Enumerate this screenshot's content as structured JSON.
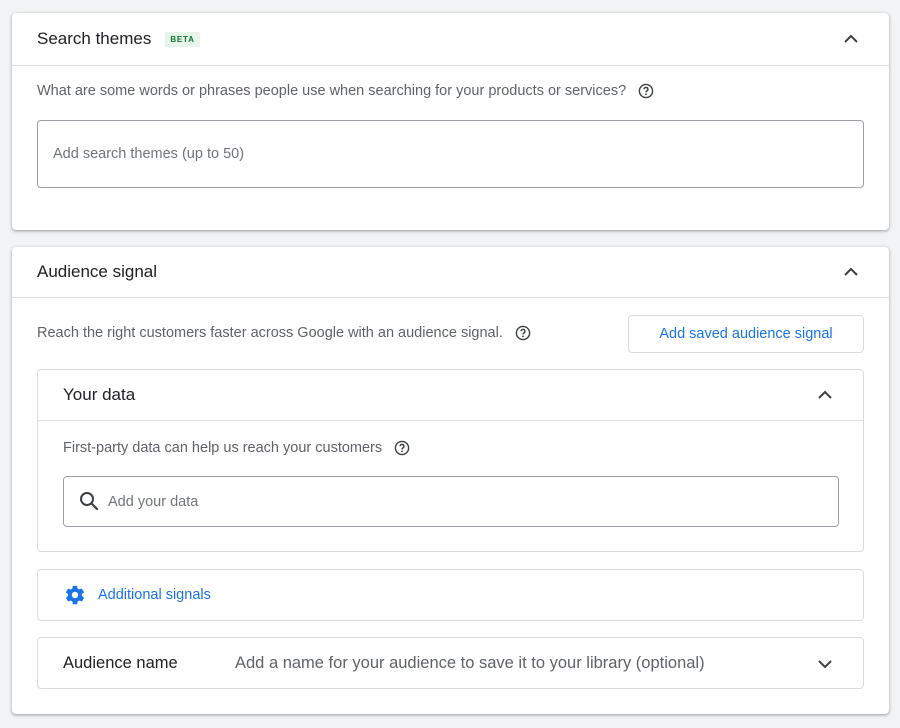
{
  "search_themes": {
    "title": "Search themes",
    "badge": "BETA",
    "question": "What are some words or phrases people use when searching for your products or services?",
    "input_placeholder": "Add search themes (up to 50)",
    "chevron_icon": "chevron-up-icon",
    "help_icon": "help-circle-icon"
  },
  "audience_signal": {
    "title": "Audience signal",
    "description": "Reach the right customers faster across Google with an audience signal.",
    "add_saved_button": "Add saved audience signal",
    "your_data": {
      "title": "Your data",
      "description": "First-party data can help us reach your customers",
      "input_placeholder": "Add your data",
      "search_icon": "search-icon"
    },
    "additional_signals": {
      "label": "Additional signals",
      "icon": "gear-icon"
    },
    "audience_name": {
      "label": "Audience name",
      "placeholder": "Add a name for your audience to save it to your library (optional)",
      "chevron_icon": "chevron-down-icon"
    }
  },
  "colors": {
    "accent": "#1a73e8",
    "badge_bg": "#e6f4ea",
    "badge_text": "#137333",
    "secondary_text": "#5f6368",
    "border": "#dadce0"
  }
}
